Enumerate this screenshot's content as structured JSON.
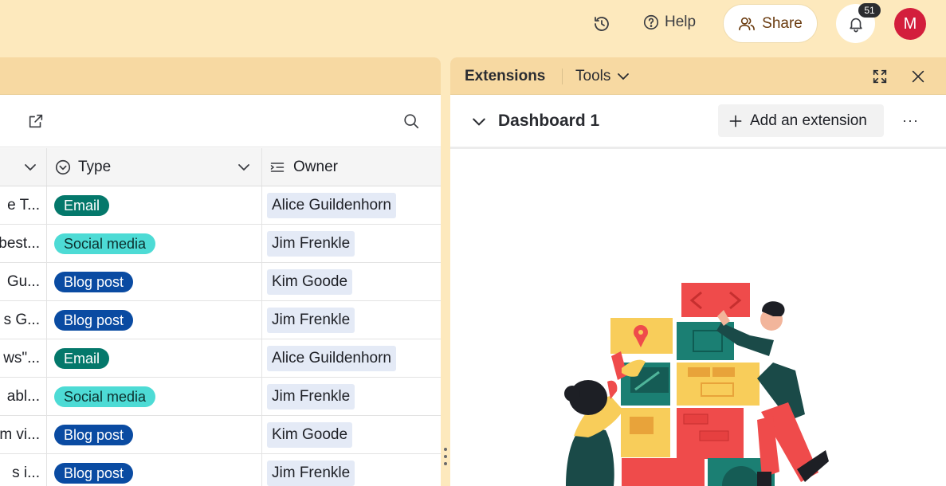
{
  "topbar": {
    "help_label": "Help",
    "share_label": "Share",
    "notification_count": "51",
    "avatar_initial": "M"
  },
  "grid": {
    "columns": [
      {
        "label": ""
      },
      {
        "label": "Type"
      },
      {
        "label": "Owner"
      }
    ],
    "rows": [
      {
        "name": "e T...",
        "type": "Email",
        "type_kind": "email",
        "owner": "Alice Guildenhorn"
      },
      {
        "name": "best...",
        "type": "Social media",
        "type_kind": "social",
        "owner": "Jim Frenkle"
      },
      {
        "name": "Gu...",
        "type": "Blog post",
        "type_kind": "blog",
        "owner": "Kim Goode"
      },
      {
        "name": "s G...",
        "type": "Blog post",
        "type_kind": "blog",
        "owner": "Jim Frenkle"
      },
      {
        "name": "ws\"...",
        "type": "Email",
        "type_kind": "email",
        "owner": "Alice Guildenhorn"
      },
      {
        "name": "abl...",
        "type": "Social media",
        "type_kind": "social",
        "owner": "Jim Frenkle"
      },
      {
        "name": "m vi...",
        "type": "Blog post",
        "type_kind": "blog",
        "owner": "Kim Goode"
      },
      {
        "name": "s i...",
        "type": "Blog post",
        "type_kind": "blog",
        "owner": "Jim Frenkle"
      }
    ]
  },
  "extensions_panel": {
    "title": "Extensions",
    "tools_label": "Tools",
    "dashboard_title": "Dashboard 1",
    "add_extension_label": "Add an extension",
    "more_label": "···"
  },
  "colors": {
    "email_pill": "#04786b",
    "social_pill": "#4ddbd5",
    "blog_pill": "#0a4ba2",
    "header_bg": "#fde9bd",
    "avatar": "#d31e3c"
  }
}
